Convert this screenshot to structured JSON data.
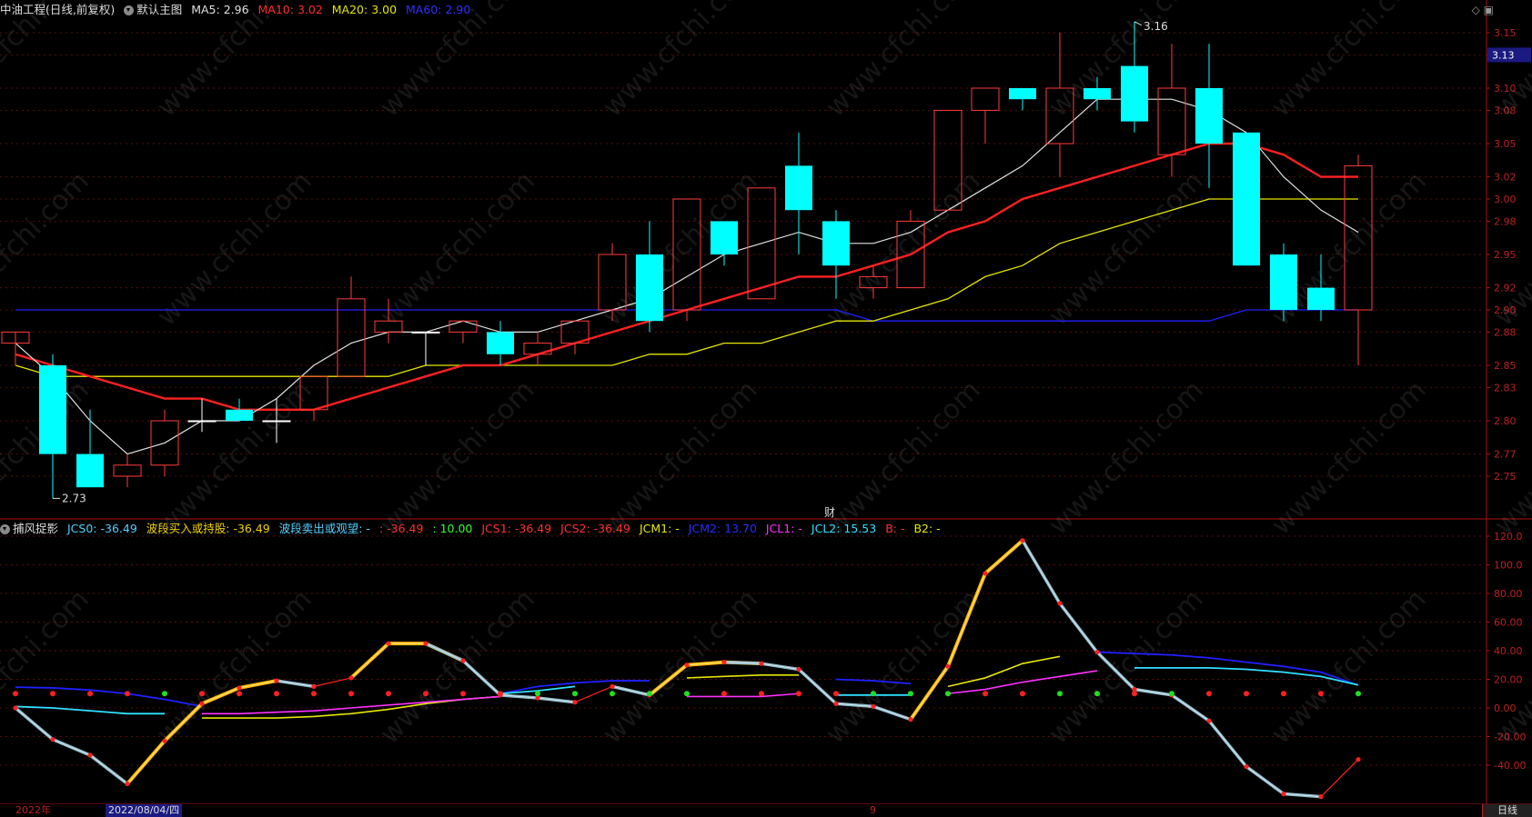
{
  "header": {
    "stock": "中油工程(日线,前复权)",
    "main_chart": "默认主图",
    "ma5": "MA5: 2.96",
    "ma10": "MA10: 3.02",
    "ma20": "MA20: 3.00",
    "ma60": "MA60: 2.90"
  },
  "indicator_header": {
    "name": "捕风捉影",
    "jcs0": "JCS0: -36.49",
    "buy": "波段买入或持股: -36.49",
    "sell": "波段卖出或观望: -",
    "t1": ": -36.49",
    "t2": ": 10.00",
    "jcs1": "JCS1: -36.49",
    "jcs2": "JCS2: -36.49",
    "jcm1": "JCM1: -",
    "jcm2": "JCM2: 13.70",
    "jcl1": "JCL1: -",
    "jcl2": "JCL2: 15.53",
    "b": "B: -",
    "b2": "B2: -"
  },
  "annotations": {
    "high": "3.16",
    "low": "2.73",
    "finance": "财",
    "last_price": "3.13"
  },
  "dates": {
    "year": "2022年",
    "selected": "2022/08/04/四",
    "mark": "9",
    "period": "日线"
  },
  "price_axis": [
    "3.15",
    "3.13",
    "3.10",
    "3.08",
    "3.05",
    "3.02",
    "3.00",
    "2.98",
    "2.95",
    "2.92",
    "2.90",
    "2.88",
    "2.85",
    "2.83",
    "2.80",
    "2.77",
    "2.75"
  ],
  "ind_axis": [
    "120.0",
    "100.0",
    "80.00",
    "60.00",
    "40.00",
    "20.00",
    "0.00",
    "-20.00",
    "-40.00"
  ],
  "colors": {
    "up": "#ff3b3b",
    "down": "#00ffff",
    "ma5": "#e0e0e0",
    "ma10": "#ff2020",
    "ma20": "#e6e600",
    "ma60": "#2020ff"
  },
  "chart_data": {
    "type": "candlestick",
    "candles": [
      {
        "o": 2.87,
        "h": 2.87,
        "l": 2.85,
        "c": 2.88
      },
      {
        "o": 2.85,
        "h": 2.86,
        "l": 2.73,
        "c": 2.77
      },
      {
        "o": 2.77,
        "h": 2.81,
        "l": 2.74,
        "c": 2.74
      },
      {
        "o": 2.75,
        "h": 2.77,
        "l": 2.74,
        "c": 2.76
      },
      {
        "o": 2.76,
        "h": 2.81,
        "l": 2.75,
        "c": 2.8
      },
      {
        "o": 2.8,
        "h": 2.82,
        "l": 2.79,
        "c": 2.8
      },
      {
        "o": 2.81,
        "h": 2.82,
        "l": 2.8,
        "c": 2.8
      },
      {
        "o": 2.8,
        "h": 2.82,
        "l": 2.78,
        "c": 2.8
      },
      {
        "o": 2.81,
        "h": 2.84,
        "l": 2.8,
        "c": 2.84
      },
      {
        "o": 2.84,
        "h": 2.93,
        "l": 2.84,
        "c": 2.91
      },
      {
        "o": 2.88,
        "h": 2.91,
        "l": 2.87,
        "c": 2.89
      },
      {
        "o": 2.88,
        "h": 2.88,
        "l": 2.85,
        "c": 2.88
      },
      {
        "o": 2.88,
        "h": 2.89,
        "l": 2.87,
        "c": 2.89
      },
      {
        "o": 2.88,
        "h": 2.89,
        "l": 2.85,
        "c": 2.86
      },
      {
        "o": 2.86,
        "h": 2.88,
        "l": 2.85,
        "c": 2.87
      },
      {
        "o": 2.87,
        "h": 2.89,
        "l": 2.86,
        "c": 2.89
      },
      {
        "o": 2.9,
        "h": 2.96,
        "l": 2.89,
        "c": 2.95
      },
      {
        "o": 2.95,
        "h": 2.98,
        "l": 2.88,
        "c": 2.89
      },
      {
        "o": 2.9,
        "h": 3.0,
        "l": 2.89,
        "c": 3.0
      },
      {
        "o": 2.98,
        "h": 2.98,
        "l": 2.94,
        "c": 2.95
      },
      {
        "o": 2.91,
        "h": 3.01,
        "l": 2.91,
        "c": 3.01
      },
      {
        "o": 3.03,
        "h": 3.06,
        "l": 2.95,
        "c": 2.99
      },
      {
        "o": 2.98,
        "h": 2.99,
        "l": 2.91,
        "c": 2.94
      },
      {
        "o": 2.92,
        "h": 2.94,
        "l": 2.91,
        "c": 2.93
      },
      {
        "o": 2.92,
        "h": 2.99,
        "l": 2.92,
        "c": 2.98
      },
      {
        "o": 2.99,
        "h": 3.08,
        "l": 2.99,
        "c": 3.08
      },
      {
        "o": 3.08,
        "h": 3.1,
        "l": 3.05,
        "c": 3.1
      },
      {
        "o": 3.1,
        "h": 3.1,
        "l": 3.08,
        "c": 3.09
      },
      {
        "o": 3.05,
        "h": 3.15,
        "l": 3.02,
        "c": 3.1
      },
      {
        "o": 3.1,
        "h": 3.11,
        "l": 3.08,
        "c": 3.09
      },
      {
        "o": 3.12,
        "h": 3.16,
        "l": 3.06,
        "c": 3.07
      },
      {
        "o": 3.04,
        "h": 3.14,
        "l": 3.02,
        "c": 3.1
      },
      {
        "o": 3.1,
        "h": 3.14,
        "l": 3.01,
        "c": 3.05
      },
      {
        "o": 3.06,
        "h": 3.06,
        "l": 2.94,
        "c": 2.94
      },
      {
        "o": 2.95,
        "h": 2.96,
        "l": 2.89,
        "c": 2.9
      },
      {
        "o": 2.92,
        "h": 2.95,
        "l": 2.89,
        "c": 2.9
      },
      {
        "o": 2.9,
        "h": 3.04,
        "l": 2.85,
        "c": 3.03
      }
    ],
    "ma5": [
      2.87,
      2.84,
      2.8,
      2.77,
      2.78,
      2.8,
      2.8,
      2.82,
      2.85,
      2.87,
      2.88,
      2.88,
      2.89,
      2.88,
      2.88,
      2.89,
      2.9,
      2.91,
      2.93,
      2.95,
      2.96,
      2.97,
      2.96,
      2.96,
      2.97,
      2.99,
      3.01,
      3.03,
      3.06,
      3.09,
      3.09,
      3.09,
      3.08,
      3.06,
      3.02,
      2.99,
      2.97
    ],
    "ma10": [
      2.86,
      2.85,
      2.84,
      2.83,
      2.82,
      2.82,
      2.81,
      2.81,
      2.81,
      2.82,
      2.83,
      2.84,
      2.85,
      2.85,
      2.86,
      2.87,
      2.88,
      2.89,
      2.9,
      2.91,
      2.92,
      2.93,
      2.93,
      2.94,
      2.95,
      2.97,
      2.98,
      3.0,
      3.01,
      3.02,
      3.03,
      3.04,
      3.05,
      3.05,
      3.04,
      3.02,
      3.02
    ],
    "ma20": [
      2.85,
      2.84,
      2.84,
      2.84,
      2.84,
      2.84,
      2.84,
      2.84,
      2.84,
      2.84,
      2.84,
      2.85,
      2.85,
      2.85,
      2.85,
      2.85,
      2.85,
      2.86,
      2.86,
      2.87,
      2.87,
      2.88,
      2.89,
      2.89,
      2.9,
      2.91,
      2.93,
      2.94,
      2.96,
      2.97,
      2.98,
      2.99,
      3.0,
      3.0,
      3.0,
      3.0,
      3.0
    ],
    "ma60": [
      2.9,
      2.9,
      2.9,
      2.9,
      2.9,
      2.9,
      2.9,
      2.9,
      2.9,
      2.9,
      2.9,
      2.9,
      2.9,
      2.9,
      2.9,
      2.9,
      2.9,
      2.9,
      2.9,
      2.9,
      2.9,
      2.9,
      2.9,
      2.89,
      2.89,
      2.89,
      2.89,
      2.89,
      2.89,
      2.89,
      2.89,
      2.89,
      2.89,
      2.9,
      2.9,
      2.9,
      2.9
    ],
    "jcs": [
      0,
      -22,
      -33,
      -53,
      -23,
      3,
      14,
      19,
      15,
      21,
      45,
      45,
      33,
      9,
      7,
      4,
      15,
      9,
      30,
      32,
      31,
      27,
      3,
      1,
      -8,
      29,
      94,
      117,
      73,
      39,
      13,
      9,
      -9,
      -41,
      -60,
      -62,
      -36
    ],
    "jcs_bold": [
      [
        3,
        7
      ],
      [
        9,
        12
      ],
      [
        17,
        20
      ],
      [
        24,
        27
      ]
    ],
    "jcm2": [
      [
        0,
        14.5
      ],
      [
        1,
        14
      ],
      [
        2,
        12.5
      ],
      [
        3,
        10
      ],
      [
        4,
        6
      ],
      [
        5,
        1
      ],
      [
        6,
        null
      ],
      [
        13,
        10
      ],
      [
        14,
        15
      ],
      [
        15,
        17.5
      ],
      [
        16,
        19
      ],
      [
        17,
        19
      ],
      [
        22,
        20
      ],
      [
        23,
        19
      ],
      [
        24,
        17
      ],
      [
        29,
        39
      ],
      [
        30,
        38
      ],
      [
        31,
        37
      ],
      [
        32,
        35
      ],
      [
        33,
        32
      ],
      [
        34,
        29
      ],
      [
        35,
        25
      ],
      [
        36,
        16
      ]
    ],
    "jcl2": [
      [
        0,
        1
      ],
      [
        1,
        0
      ],
      [
        2,
        -2
      ],
      [
        3,
        -4
      ],
      [
        4,
        -4
      ],
      [
        13,
        10
      ],
      [
        14,
        12
      ],
      [
        15,
        15
      ],
      [
        22,
        9
      ],
      [
        23,
        9
      ],
      [
        24,
        9
      ],
      [
        30,
        28
      ],
      [
        31,
        28
      ],
      [
        32,
        28
      ],
      [
        33,
        27
      ],
      [
        34,
        25
      ],
      [
        35,
        22
      ],
      [
        36,
        16
      ]
    ],
    "yellow": [
      [
        5,
        -7
      ],
      [
        6,
        -7
      ],
      [
        7,
        -7
      ],
      [
        8,
        -6
      ],
      [
        9,
        -4
      ],
      [
        10,
        -1
      ],
      [
        11,
        3
      ],
      [
        12,
        6
      ],
      [
        13,
        8
      ],
      [
        18,
        21
      ],
      [
        19,
        22
      ],
      [
        20,
        23
      ],
      [
        21,
        23
      ],
      [
        25,
        15
      ],
      [
        26,
        21
      ],
      [
        27,
        31
      ],
      [
        28,
        36
      ]
    ],
    "magenta": [
      [
        5,
        -4
      ],
      [
        6,
        -4
      ],
      [
        7,
        -3
      ],
      [
        8,
        -2
      ],
      [
        9,
        0
      ],
      [
        10,
        2
      ],
      [
        11,
        4
      ],
      [
        12,
        6
      ],
      [
        13,
        8
      ],
      [
        18,
        8
      ],
      [
        19,
        8
      ],
      [
        20,
        8
      ],
      [
        21,
        10
      ],
      [
        25,
        10
      ],
      [
        26,
        13
      ],
      [
        27,
        18
      ],
      [
        28,
        22
      ],
      [
        29,
        26
      ]
    ],
    "dots": [
      "r",
      "r",
      "r",
      "r",
      "g",
      "r",
      "r",
      "r",
      "r",
      "r",
      "r",
      "r",
      "r",
      "r",
      "g",
      "g",
      "g",
      "g",
      "g",
      "r",
      "r",
      "r",
      "r",
      "g",
      "g",
      "g",
      "r",
      "r",
      "g",
      "g",
      "r",
      "g",
      "r",
      "r",
      "r",
      "r",
      "g"
    ]
  }
}
